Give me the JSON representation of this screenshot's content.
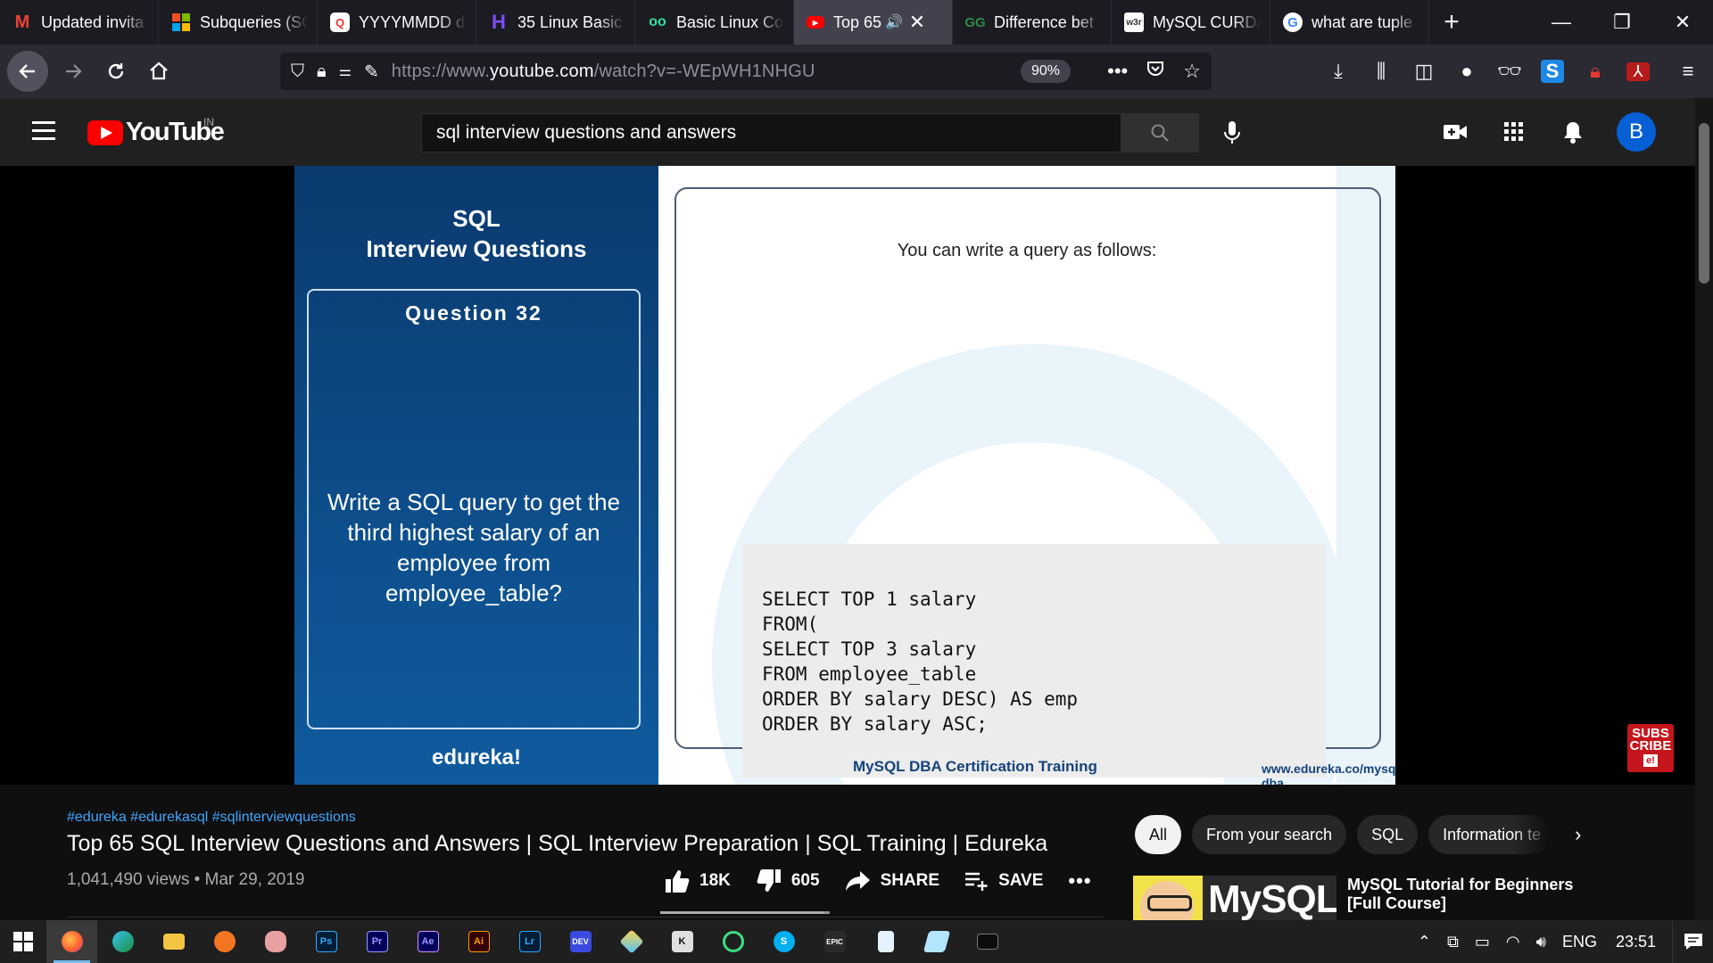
{
  "browser": {
    "tabs": [
      {
        "title": "Updated invita",
        "icon": "gmail-icon",
        "color": "#ea4335"
      },
      {
        "title": "Subqueries (SC",
        "icon": "microsoft-icon",
        "color": "#f25022"
      },
      {
        "title": "YYYYMMDD d",
        "icon": "app-icon",
        "color": "#e53935"
      },
      {
        "title": "35 Linux Basic",
        "icon": "hashnode-icon",
        "color": "#7c4dff"
      },
      {
        "title": "Basic Linux Co",
        "icon": "tripadvisor-icon",
        "color": "#34e0a1"
      },
      {
        "title": "Top 65",
        "icon": "youtube-icon",
        "color": "#ff0000",
        "active": true
      },
      {
        "title": "Difference bet",
        "icon": "gfg-icon",
        "color": "#2f8d46"
      },
      {
        "title": "MySQL CURDA",
        "icon": "w3schools-icon",
        "color": "#ffffff"
      },
      {
        "title": "what are tuple",
        "icon": "google-icon",
        "color": "#4285f4"
      }
    ],
    "new_tab": "+",
    "url_prefix": "https://www.",
    "url_domain": "youtube.com",
    "url_path": "/watch?v=-WEpWH1NHGU",
    "zoom": "90%"
  },
  "youtube": {
    "logo_text": "YouTube",
    "country": "IN",
    "search_query": "sql interview questions and answers",
    "avatar_letter": "B"
  },
  "slide": {
    "title_line1": "SQL",
    "title_line2": "Interview Questions",
    "question_number": "Question 32",
    "question_text": "Write a SQL query to get the third highest salary of an employee from employee_table?",
    "brand": "edureka!",
    "intro": "You can write a query as follows:",
    "code": "SELECT TOP 1 salary\nFROM(\nSELECT TOP 3 salary\nFROM employee_table\nORDER BY salary DESC) AS emp\nORDER BY salary ASC;",
    "footer_course": "MySQL DBA Certification Training",
    "footer_url": "www.edureka.co/mysql-dba",
    "subscribe_line1": "SUBS",
    "subscribe_line2": "CRIBE",
    "subscribe_badge": "e!"
  },
  "video": {
    "hashtags": "#edureka #edurekasql #sqlinterviewquestions",
    "title": "Top 65 SQL Interview Questions and Answers | SQL Interview Preparation | SQL Training | Edureka",
    "views_date": "1,041,490 views • Mar 29, 2019",
    "likes": "18K",
    "dislikes": "605",
    "share_label": "SHARE",
    "save_label": "SAVE",
    "more_label": "•••",
    "like_ratio": 0.967
  },
  "related": {
    "chips": [
      "All",
      "From your search",
      "SQL",
      "Information te"
    ],
    "thumb_text": "MySQL",
    "first_title_line1": "MySQL Tutorial for Beginners",
    "first_title_line2": "[Full Course]"
  },
  "taskbar": {
    "apps": [
      "firefox",
      "edge",
      "file-explorer",
      "crunchyroll",
      "brain",
      "photoshop",
      "premiere",
      "after-effects",
      "illustrator",
      "lightroom",
      "dev",
      "cube",
      "kali",
      "spinner",
      "skype",
      "epic",
      "notepad",
      "notes",
      "terminal"
    ],
    "language": "ENG",
    "time": "23:51"
  }
}
